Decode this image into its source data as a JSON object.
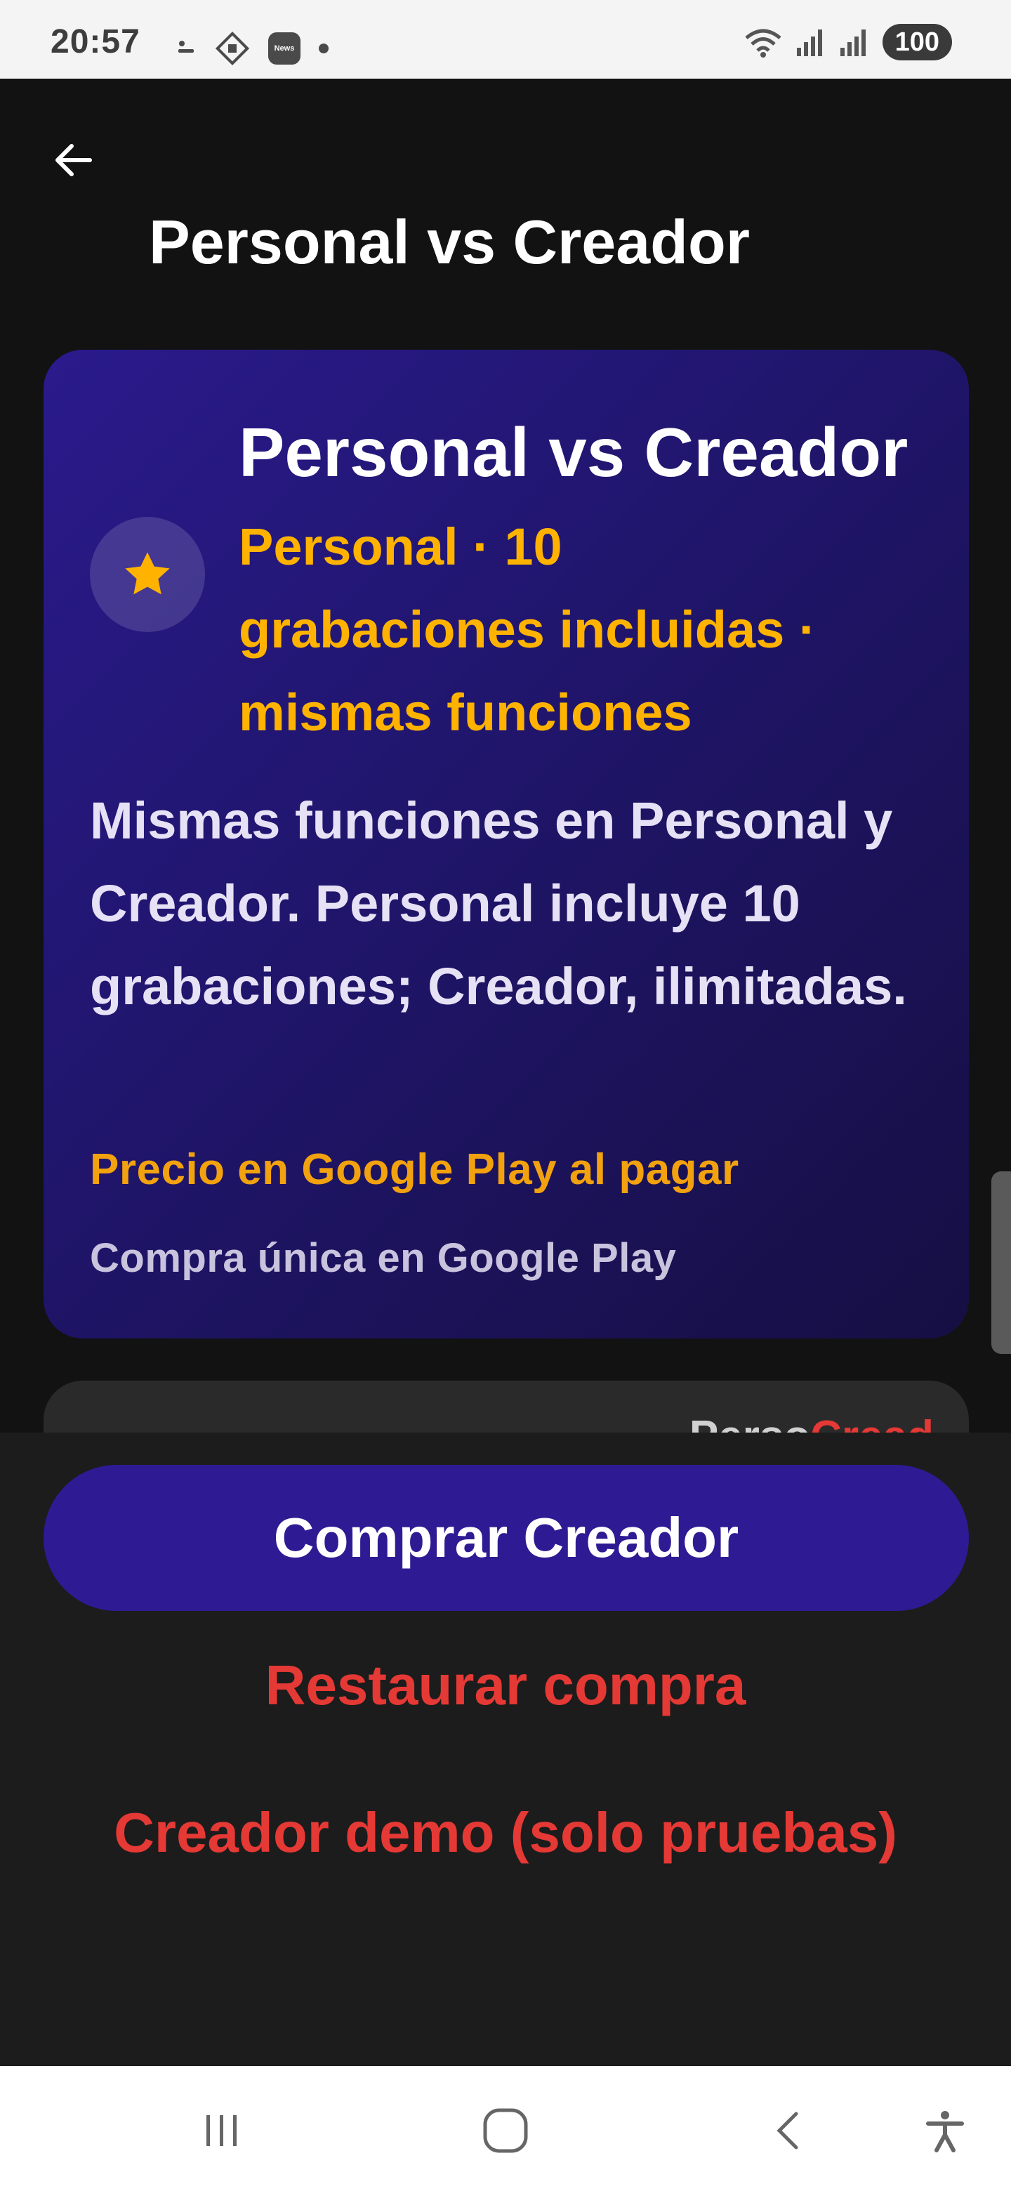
{
  "status_bar": {
    "time": "20:57",
    "news_badge": "News",
    "battery": "100",
    "icons": [
      "dash-icon",
      "puzzle-icon",
      "news-icon",
      "dot-icon",
      "wifi-icon",
      "signal-icon",
      "signal-icon",
      "battery-icon"
    ]
  },
  "app_bar": {
    "title": "Personal vs Creador",
    "back_icon": "arrow-left-icon"
  },
  "hero": {
    "icon": "star-icon",
    "title": "Personal vs Creador",
    "subtitle": "Personal · 10 grabaciones incluidas · mismas funciones",
    "description": "Mismas funciones en Personal y Creador. Personal incluye 10 grabaciones; Creador, ilimitadas.",
    "price_note": "Precio en Google Play al pagar",
    "purchase_type": "Compra única en Google Play"
  },
  "comparison": {
    "col_personal": "Perso",
    "col_creador": "Cread"
  },
  "actions": {
    "buy_label": "Comprar Creador",
    "restore_label": "Restaurar compra",
    "demo_label": "Creador demo (solo pruebas)"
  },
  "nav": {
    "recents_icon": "recents-icon",
    "home_icon": "home-icon",
    "back_icon": "back-icon",
    "accessibility_icon": "accessibility-icon"
  },
  "colors": {
    "accent_orange": "#ffb300",
    "accent_red": "#e53935",
    "button_purple": "#2e1b93",
    "card_gradient_start": "#2a1a8c",
    "card_gradient_end": "#160f43"
  }
}
